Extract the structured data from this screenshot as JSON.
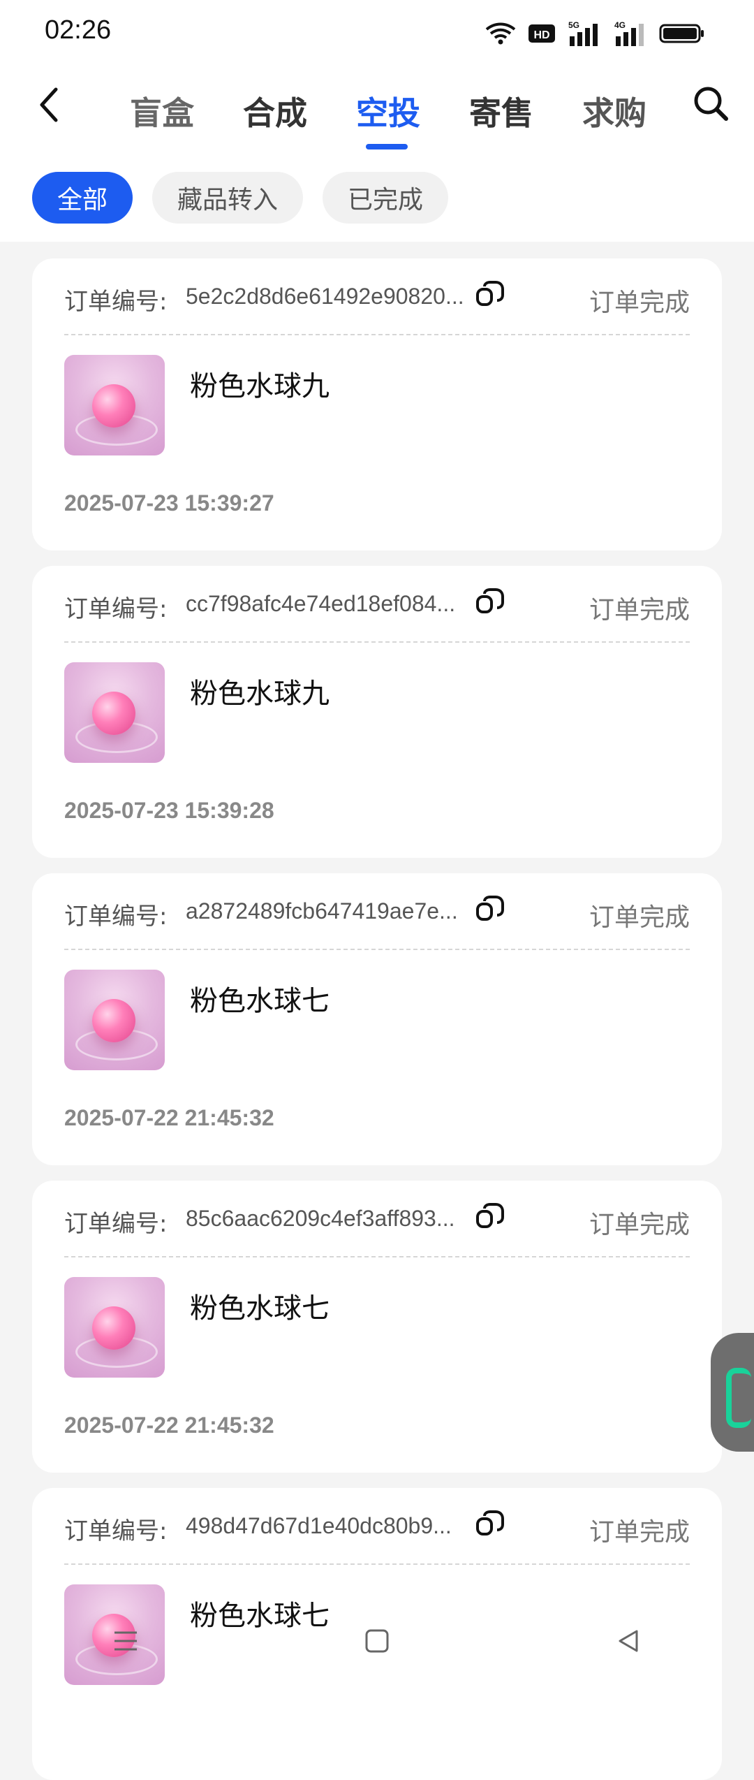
{
  "status_bar": {
    "time": "02:26",
    "icons": [
      "wifi-icon",
      "hd-icon",
      "signal-5g-icon",
      "signal-4g-icon",
      "battery-icon"
    ]
  },
  "header": {
    "tabs": [
      {
        "label": "盲盒"
      },
      {
        "label": "合成"
      },
      {
        "label": "空投"
      },
      {
        "label": "寄售"
      },
      {
        "label": "求购"
      }
    ],
    "active_tab": "空投"
  },
  "filters": [
    {
      "label": "全部"
    },
    {
      "label": "藏品转入"
    },
    {
      "label": "已完成"
    }
  ],
  "order_prefix": "订单编号:",
  "orders": [
    {
      "id": "5e2c2d8d6e61492e90820...",
      "status": "订单完成",
      "item": "粉色水球九",
      "time": "2025-07-23 15:39:27"
    },
    {
      "id": "cc7f98afc4e74ed18ef084...",
      "status": "订单完成",
      "item": "粉色水球九",
      "time": "2025-07-23 15:39:28"
    },
    {
      "id": "a2872489fcb647419ae7e...",
      "status": "订单完成",
      "item": "粉色水球七",
      "time": "2025-07-22 21:45:32"
    },
    {
      "id": "85c6aac6209c4ef3aff893...",
      "status": "订单完成",
      "item": "粉色水球七",
      "time": "2025-07-22 21:45:32"
    },
    {
      "id": "498d47d67d1e40dc80b9...",
      "status": "订单完成",
      "item": "粉色水球七",
      "time": ""
    }
  ],
  "colors": {
    "accent": "#1d5cf0",
    "background": "#f4f4f4",
    "card": "#ffffff"
  }
}
